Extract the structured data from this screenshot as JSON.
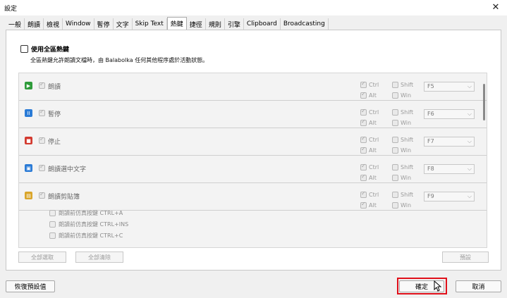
{
  "window": {
    "title": "設定",
    "close_glyph": "✕"
  },
  "tabs": [
    {
      "label": "一般",
      "active": false
    },
    {
      "label": "朗讀",
      "active": false
    },
    {
      "label": "檢視",
      "active": false
    },
    {
      "label": "Window",
      "active": false
    },
    {
      "label": "暫停",
      "active": false
    },
    {
      "label": "文字",
      "active": false
    },
    {
      "label": "Skip Text",
      "active": false
    },
    {
      "label": "熱鍵",
      "active": true
    },
    {
      "label": "捷徑",
      "active": false
    },
    {
      "label": "規則",
      "active": false
    },
    {
      "label": "引擎",
      "active": false
    },
    {
      "label": "Clipboard",
      "active": false
    },
    {
      "label": "Broadcasting",
      "active": false
    }
  ],
  "hotkeys_panel": {
    "master_checkbox_label": "使用全區熱鍵",
    "master_checked": false,
    "description": "全區熱鍵允許朗讀文檔時，由 Balabolka 任何其他程序處於活動狀態。",
    "rows": [
      {
        "label": "朗讀",
        "icon": "play-icon",
        "icon_color": "#2e9b3a",
        "key": "F5",
        "ctrl": true,
        "alt": true,
        "shift": false,
        "win": false
      },
      {
        "label": "暫停",
        "icon": "pause-icon",
        "icon_color": "#2b7bd6",
        "key": "F6",
        "ctrl": true,
        "alt": true,
        "shift": false,
        "win": false
      },
      {
        "label": "停止",
        "icon": "stop-icon",
        "icon_color": "#d33a2f",
        "key": "F7",
        "ctrl": true,
        "alt": true,
        "shift": false,
        "win": false
      },
      {
        "label": "朗讀選中文字",
        "icon": "read-selection-icon",
        "icon_color": "#2b7bd6",
        "key": "F8",
        "ctrl": true,
        "alt": true,
        "shift": false,
        "win": false
      },
      {
        "label": "朗讀剪貼簿",
        "icon": "clipboard-icon",
        "icon_color": "#d9a52a",
        "key": "F9",
        "ctrl": true,
        "alt": true,
        "shift": false,
        "win": false
      }
    ],
    "modifier_labels": {
      "ctrl": "Ctrl",
      "alt": "Alt",
      "shift": "Shift",
      "win": "Win"
    },
    "clipboard_sub_options": [
      "朗讀前仿真按鍵 CTRL+A",
      "朗讀前仿真按鍵 CTRL+INS",
      "朗讀前仿真按鍵 CTRL+C"
    ],
    "select_all_button": "全部選取",
    "clear_all_button": "全部清除",
    "preview_button": "預設"
  },
  "footer": {
    "restore_defaults_button": "恢復預設值",
    "ok_button": "確定",
    "cancel_button": "取消"
  },
  "accent": {
    "highlight_color": "#e0101a"
  }
}
